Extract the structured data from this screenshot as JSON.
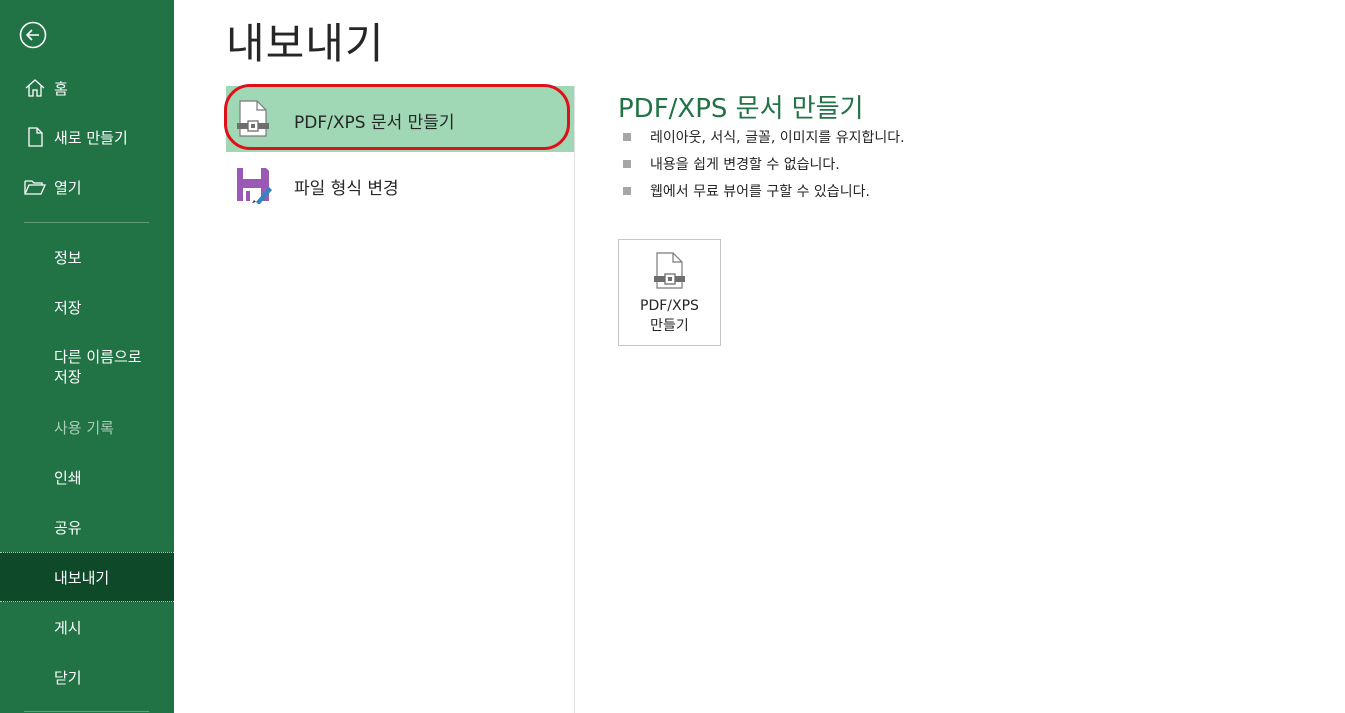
{
  "window": {
    "colors": {
      "sidebar": "#217346",
      "sidebar_active": "#0e4a29",
      "accent": "#217346",
      "selected_option": "#a0d8b5",
      "highlight": "#e0101a"
    }
  },
  "sidebar": {
    "back_icon": "back-arrow-icon",
    "items": [
      {
        "label": "홈",
        "icon": "home-icon"
      },
      {
        "label": "새로 만들기",
        "icon": "new-file-icon"
      },
      {
        "label": "열기",
        "icon": "open-folder-icon"
      },
      {
        "label": "정보"
      },
      {
        "label": "저장"
      },
      {
        "label": "다른 이름으로\n저장"
      },
      {
        "label": "사용 기록",
        "disabled": true
      },
      {
        "label": "인쇄"
      },
      {
        "label": "공유"
      },
      {
        "label": "내보내기",
        "active": true
      },
      {
        "label": "게시"
      },
      {
        "label": "닫기"
      }
    ]
  },
  "main": {
    "title": "내보내기",
    "options": [
      {
        "label": "PDF/XPS 문서 만들기",
        "icon": "pdf-document-icon",
        "selected": true
      },
      {
        "label": "파일 형식 변경",
        "icon": "save-as-format-icon",
        "selected": false
      }
    ],
    "detail": {
      "title": "PDF/XPS 문서 만들기",
      "bullets": [
        "레이아웃, 서식, 글꼴, 이미지를 유지합니다.",
        "내용을 쉽게 변경할 수 없습니다.",
        "웹에서 무료 뷰어를 구할 수 있습니다."
      ],
      "button_label": "PDF/XPS\n만들기",
      "button_icon": "pdf-document-icon"
    }
  }
}
